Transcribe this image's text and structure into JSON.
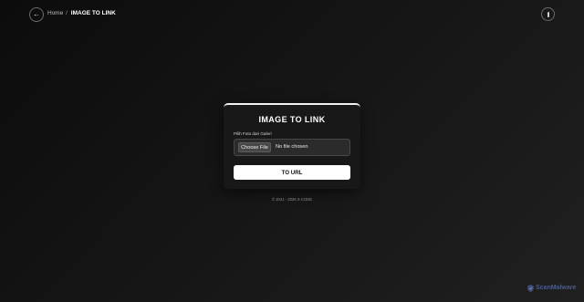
{
  "header": {
    "back_icon": "arrow-left-icon",
    "breadcrumb": {
      "home": "Home",
      "separator": "/",
      "current": "IMAGE TO LINK"
    },
    "menu_icon": "menu-icon"
  },
  "card": {
    "title": "IMAGE TO LINK",
    "field_label": "Pilih Foto dari Galeri",
    "file_input": {
      "button_label": "Choose File",
      "status": "No file chosen"
    },
    "submit_label": "TO URL"
  },
  "footer": {
    "text": "© 2021 - 2026 X-CODE"
  },
  "watermark": {
    "text": "ScanMalware",
    "color": "#4d5b86"
  },
  "colors": {
    "background": "#111111",
    "card": "#181818",
    "accent": "#ffffff"
  }
}
